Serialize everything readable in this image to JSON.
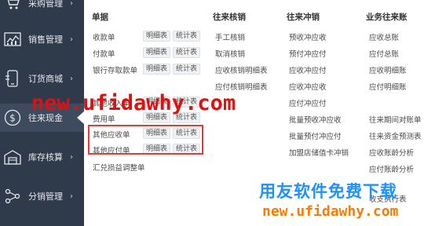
{
  "sidebar": {
    "items": [
      {
        "label": "采购管理",
        "icon": "cart-icon"
      },
      {
        "label": "销售管理",
        "icon": "chart-icon"
      },
      {
        "label": "订货商城",
        "icon": "phone-icon"
      },
      {
        "label": "往来现金",
        "icon": "dollar-icon"
      },
      {
        "label": "库存核算",
        "icon": "warehouse-icon"
      },
      {
        "label": "分销管理",
        "icon": "network-icon"
      }
    ]
  },
  "columns": {
    "documents": {
      "title": "单据",
      "rows": [
        {
          "label": "收款单",
          "tags": [
            "明细表",
            "统计表"
          ]
        },
        {
          "label": "付款单",
          "tags": [
            "明细表",
            "统计表"
          ]
        },
        {
          "label": "银行存取款单",
          "tags": [
            "明细表",
            "统计表"
          ]
        },
        {
          "label": "其他收入单",
          "tags": [
            "明细表",
            "统计表"
          ]
        },
        {
          "label": "费用单",
          "tags": [
            "明细表",
            "统计表"
          ]
        },
        {
          "label": "其他应收单",
          "tags": [
            "明细表",
            "统计表"
          ]
        },
        {
          "label": "其他应付单",
          "tags": [
            "明细表",
            "统计表"
          ]
        },
        {
          "label": "汇兑损益调整单",
          "tags": []
        }
      ]
    },
    "verification": {
      "title": "往来核销",
      "items": [
        "手工核销",
        "取消核销",
        "应收核销明细表",
        "应付核销明细表"
      ]
    },
    "offset": {
      "title": "往来冲销",
      "items": [
        "预收冲应收",
        "预付冲应付",
        "应收冲应付",
        "应收冲应收",
        "应付冲应付",
        "批量预收冲应收",
        "批量预付冲应付",
        "加盟店储值卡冲销"
      ]
    },
    "business": {
      "title": "业务往来账",
      "items": [
        "应收总账",
        "应付总账",
        "应收明细账",
        "应付明细账",
        "往来期间对账单",
        "往来资金预测表",
        "应收账龄分析",
        "应付账龄分析",
        "收支执行表"
      ]
    }
  },
  "watermarks": {
    "url_red": "new.ufidawhy.com",
    "brand_blue": "用友软件免费下载",
    "url_orange": "new.ufidawhy.com"
  }
}
